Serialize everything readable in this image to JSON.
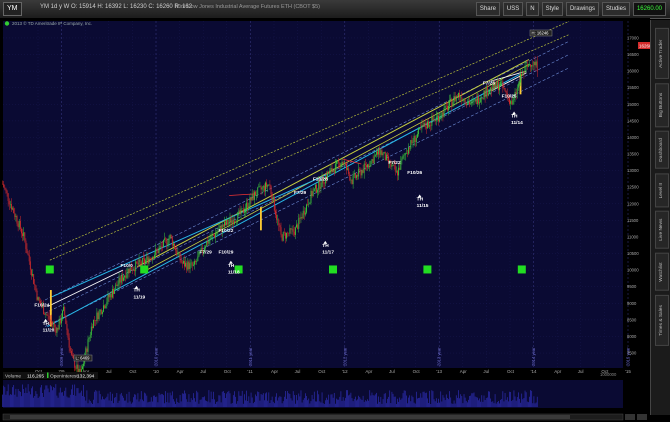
{
  "toolbar": {
    "symbol": "YM",
    "quote_text": "YM 1d y W  O: 15914  H: 16392  L: 16230  C: 16260  R: 162",
    "description": "Mini Dow Jones Industrial Average Futures ETH (CBOT $5)",
    "buttons": [
      {
        "id": "share",
        "label": "Share"
      },
      {
        "id": "symbols",
        "label": "USS"
      },
      {
        "id": "style",
        "label": "Style"
      },
      {
        "id": "drawings",
        "label": "Drawings"
      },
      {
        "id": "studies",
        "label": "Studies"
      }
    ],
    "last_price": "16260.00",
    "notes_label": "N"
  },
  "copyright": "2013 © TD Ameritrade IP Company, Inc.",
  "sidebar_tabs": [
    "Active Trader",
    "Big Buttons",
    "Dashboard",
    "Level II",
    "Live News",
    "Watchlist",
    "Times & Sales"
  ],
  "chart_data": {
    "type": "candlestick",
    "x_ticks": [
      "Oct",
      "'09",
      "Apr",
      "Jul",
      "Oct",
      "'10",
      "Apr",
      "Jul",
      "Oct",
      "'11",
      "Apr",
      "Jul",
      "Oct",
      "'12",
      "Apr",
      "Jul",
      "Oct",
      "'13",
      "Apr",
      "Jul",
      "Oct",
      "'14",
      "Apr",
      "Jul",
      "Oct",
      "'15"
    ],
    "year_labels": [
      "2009 year",
      "2010 year",
      "2011 year",
      "2012 year",
      "2013 year",
      "2014 year",
      "2015 year"
    ],
    "y_ticks": [
      17000,
      16500,
      16000,
      15500,
      15000,
      14500,
      14000,
      13500,
      13000,
      12500,
      12000,
      11500,
      11000,
      10500,
      10000,
      9500,
      9000,
      8500,
      8000,
      7500
    ],
    "ylim": [
      7200,
      17300
    ],
    "current_price_label": "16260",
    "high_label": "H: 16246",
    "low_label": "L: 6469",
    "annotations": [
      {
        "text": "F10/24",
        "x": "Oct '08",
        "y": 8900
      },
      {
        "text": "TH",
        "x": "Nov '08",
        "y": 8350
      },
      {
        "text": "11/20",
        "x": "Nov '08",
        "y": 8150
      },
      {
        "text": "F10/0",
        "x": "Sep '09",
        "y": 10100
      },
      {
        "text": "TH",
        "x": "Nov '09",
        "y": 9350
      },
      {
        "text": "11/19",
        "x": "Nov '09",
        "y": 9150
      },
      {
        "text": "F10/22",
        "x": "Oct '10",
        "y": 11150
      },
      {
        "text": "F10/29",
        "x": "Oct '10",
        "y": 10500
      },
      {
        "text": "F7/29",
        "x": "Jul '10",
        "y": 10500
      },
      {
        "text": "TH",
        "x": "Nov '10",
        "y": 10100
      },
      {
        "text": "11/18",
        "x": "Nov '10",
        "y": 9900
      },
      {
        "text": "F7/29",
        "x": "Jul '11",
        "y": 12300
      },
      {
        "text": "F10/28",
        "x": "Oct '11",
        "y": 12700
      },
      {
        "text": "TH",
        "x": "Nov '11",
        "y": 10700
      },
      {
        "text": "11/17",
        "x": "Nov '11",
        "y": 10500
      },
      {
        "text": "F7/22",
        "x": "Jul '12",
        "y": 13200
      },
      {
        "text": "F10/26",
        "x": "Oct '12",
        "y": 12900
      },
      {
        "text": "TH",
        "x": "Nov '12",
        "y": 12100
      },
      {
        "text": "11/15",
        "x": "Nov '12",
        "y": 11900
      },
      {
        "text": "F7/26",
        "x": "Jul '13",
        "y": 15600
      },
      {
        "text": "F10/25",
        "x": "Oct '13",
        "y": 15200
      },
      {
        "text": "TH",
        "x": "Nov '13",
        "y": 14600
      },
      {
        "text": "11/14",
        "x": "Nov '13",
        "y": 14400
      }
    ],
    "volume": {
      "label": "Volume",
      "value": "116,265",
      "oi_label": "OpenInterest",
      "oi_value": "132,394",
      "scale_label": "1000000"
    }
  },
  "colors": {
    "background": "#000000",
    "chart_bg": "#0a0a33",
    "up": "#3cc43c",
    "down": "#d42b2b",
    "green_box": "#22dd22",
    "channel_lines": "#c8d040",
    "cyan_line": "#28b8e8",
    "price_tag": "#d42b2b"
  }
}
